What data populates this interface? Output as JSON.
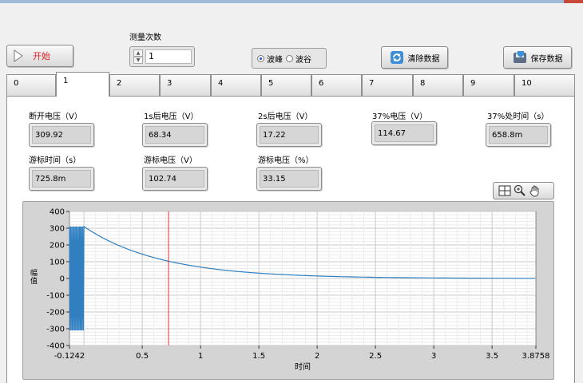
{
  "toolbar": {
    "start_label": "开始",
    "count_label": "测量次数",
    "count_value": "1",
    "mode_options": [
      {
        "label": "波峰",
        "selected": true
      },
      {
        "label": "波谷",
        "selected": false
      }
    ],
    "clear_label": "清除数据",
    "save_label": "保存数据"
  },
  "tabs": [
    "0",
    "1",
    "2",
    "3",
    "4",
    "5",
    "6",
    "7",
    "8",
    "9",
    "10"
  ],
  "active_tab": "1",
  "indicators": [
    {
      "label": "断开电压（V）",
      "value": "309.92"
    },
    {
      "label": "1s后电压（V）",
      "value": "68.34"
    },
    {
      "label": "2s后电压（V）",
      "value": "17.22"
    },
    {
      "label": "37%电压（V）",
      "value": "114.67"
    },
    {
      "label": "37%处时间（s）",
      "value": "658.8m"
    },
    {
      "label": "游标时间（s）",
      "value": "725.8m"
    },
    {
      "label": "游标电压（V）",
      "value": "102.74"
    },
    {
      "label": "游标电压（%）",
      "value": "33.15"
    }
  ],
  "graph_tools": [
    "cursor-move-icon",
    "zoom-icon",
    "pan-hand-icon"
  ],
  "chart_data": {
    "type": "line",
    "xlabel": "时间",
    "ylabel": "幅值",
    "xlim": [
      -0.1242,
      3.8758
    ],
    "ylim": [
      -400,
      400
    ],
    "x_ticks": [
      "-0.1242",
      "0.5",
      "1",
      "1.5",
      "2",
      "2.5",
      "3",
      "3.5",
      "3.8758"
    ],
    "y_ticks": [
      "400",
      "300",
      "200",
      "100",
      "0",
      "-100",
      "-200",
      "-300",
      "-400"
    ],
    "grid": true,
    "series": [
      {
        "color": "#2f7fc1",
        "oscillation": {
          "x_start": -0.1242,
          "x_end": 0.0,
          "amplitude": 309.92
        },
        "decay": {
          "start_x": 0.0,
          "start_y": 309.92,
          "time_constant": 0.6588
        }
      }
    ],
    "cursor": {
      "x": 0.7258,
      "y": 102.74,
      "color": "#e03030"
    }
  }
}
